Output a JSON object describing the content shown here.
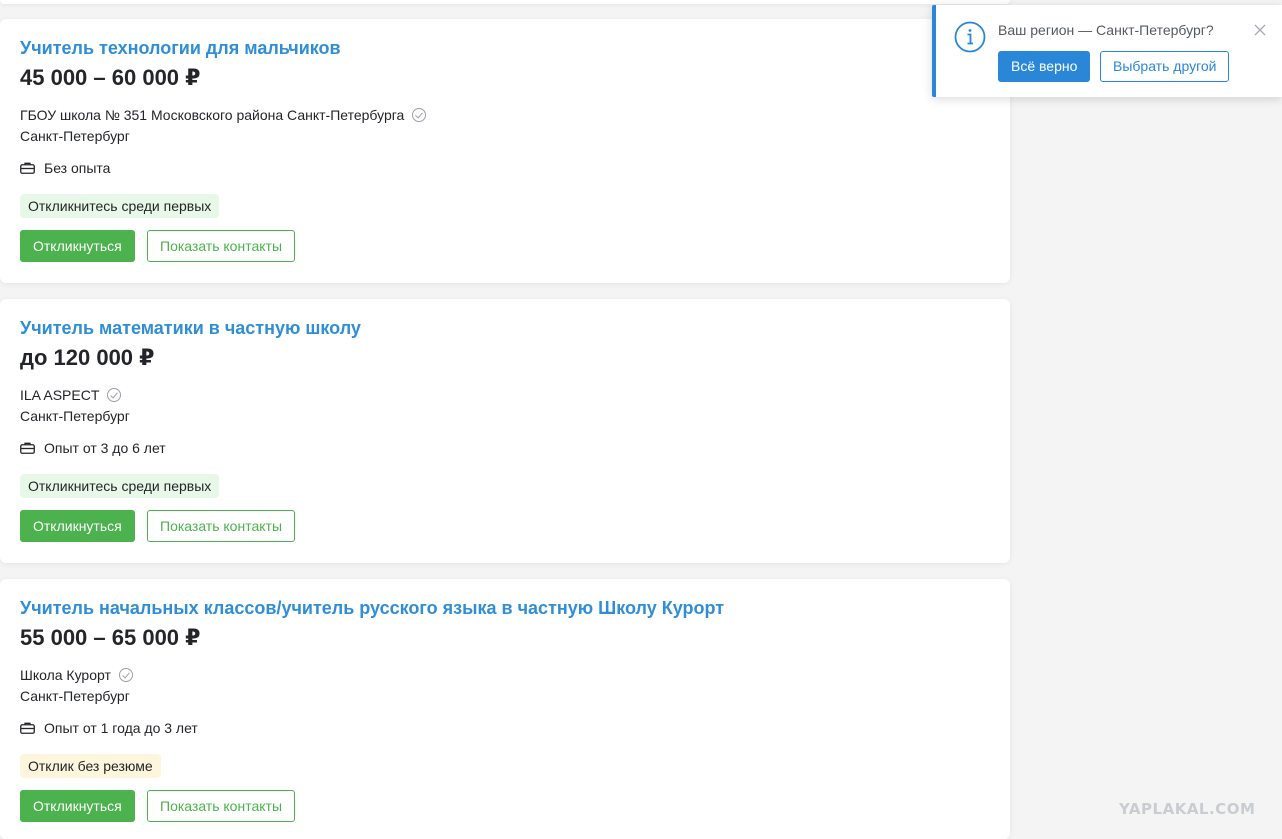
{
  "vacancies": [
    {
      "title": "Учитель технологии для мальчиков",
      "salary": "45 000 – 60 000 ₽",
      "company": "ГБОУ школа № 351 Московского района Санкт-Петербурга",
      "city": "Санкт-Петербург",
      "experience": "Без опыта",
      "badge": "Откликнитесь среди первых",
      "badge_color": "#e8f8e8",
      "respond_label": "Откликнуться",
      "contacts_label": "Показать контакты"
    },
    {
      "title": "Учитель математики в частную школу",
      "salary": "до 120 000 ₽",
      "company": "ILA ASPECT",
      "city": "Санкт-Петербург",
      "experience": "Опыт от 3 до 6 лет",
      "badge": "Откликнитесь среди первых",
      "badge_color": "#e8f8e8",
      "respond_label": "Откликнуться",
      "contacts_label": "Показать контакты"
    },
    {
      "title": "Учитель начальных классов/учитель русского языка в частную Школу Курорт",
      "salary": "55 000 – 65 000 ₽",
      "company": "Школа Курорт",
      "city": "Санкт-Петербург",
      "experience": "Опыт от 1 года до 3 лет",
      "badge": "Отклик без резюме",
      "badge_color": "#fdf5dc",
      "respond_label": "Откликнуться",
      "contacts_label": "Показать контакты"
    }
  ],
  "region_popup": {
    "question": "Ваш регион — Санкт-Петербург?",
    "confirm_label": "Всё верно",
    "choose_label": "Выбрать другой",
    "accent_color": "#2a87d8"
  },
  "watermark": "YAPLAKAL.COM",
  "colors": {
    "title": "#2f8ed6",
    "green": "#4bb24e",
    "blue": "#2a87d8"
  }
}
